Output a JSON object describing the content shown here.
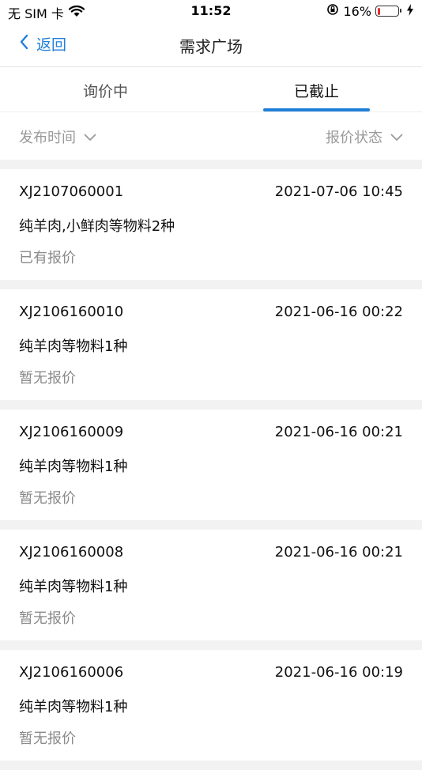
{
  "status_bar": {
    "carrier": "无 SIM 卡",
    "time": "11:52",
    "battery_percent": "16%",
    "battery_level": 0.16
  },
  "nav": {
    "back_label": "返回",
    "title": "需求广场"
  },
  "tabs": [
    {
      "label": "询价中",
      "active": false
    },
    {
      "label": "已截止",
      "active": true
    }
  ],
  "filters": {
    "left_label": "发布时间",
    "right_label": "报价状态"
  },
  "items": [
    {
      "no": "XJ2107060001",
      "date": "2021-07-06 10:45",
      "desc": "纯羊肉,小鲜肉等物料2种",
      "status": "已有报价"
    },
    {
      "no": "XJ2106160010",
      "date": "2021-06-16 00:22",
      "desc": "纯羊肉等物料1种",
      "status": "暂无报价"
    },
    {
      "no": "XJ2106160009",
      "date": "2021-06-16 00:21",
      "desc": "纯羊肉等物料1种",
      "status": "暂无报价"
    },
    {
      "no": "XJ2106160008",
      "date": "2021-06-16 00:21",
      "desc": "纯羊肉等物料1种",
      "status": "暂无报价"
    },
    {
      "no": "XJ2106160006",
      "date": "2021-06-16 00:19",
      "desc": "纯羊肉等物料1种",
      "status": "暂无报价"
    }
  ],
  "colors": {
    "accent": "#1f7fd8",
    "battery_low": "#e0302a",
    "muted_text": "#9a9a9a",
    "separator": "#f2f2f2"
  }
}
